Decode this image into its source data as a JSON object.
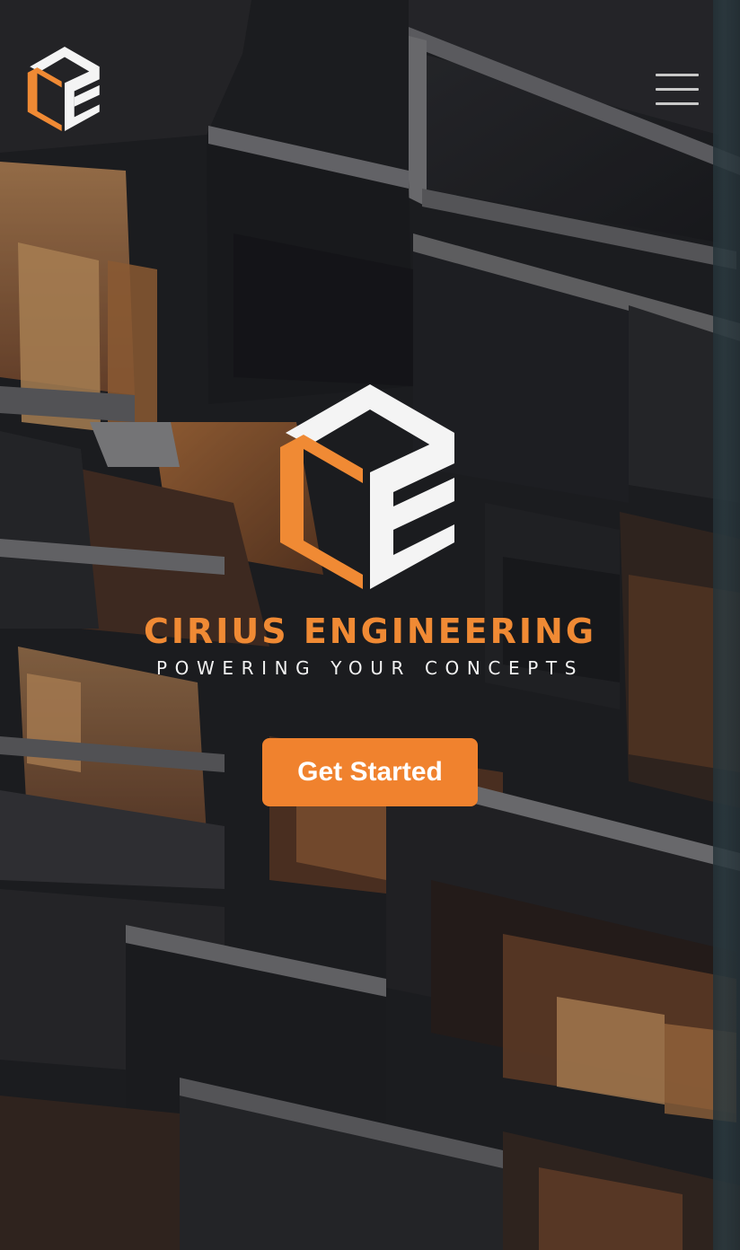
{
  "header": {
    "logo_icon": "cirius-engineering-cube-logo",
    "menu_icon": "hamburger-menu-icon"
  },
  "hero": {
    "brand_name": "CIRIUS ENGINEERING",
    "tagline": "POWERING YOUR CONCEPTS",
    "cta_label": "Get Started",
    "background": "dark building facade photo with lit orange windows"
  },
  "colors": {
    "accent": "#f0822e",
    "brand_orange": "#f08a34",
    "logo_white": "#f4f4f4",
    "menu_bar": "#c9c9c9",
    "background": "#1c1d20"
  }
}
